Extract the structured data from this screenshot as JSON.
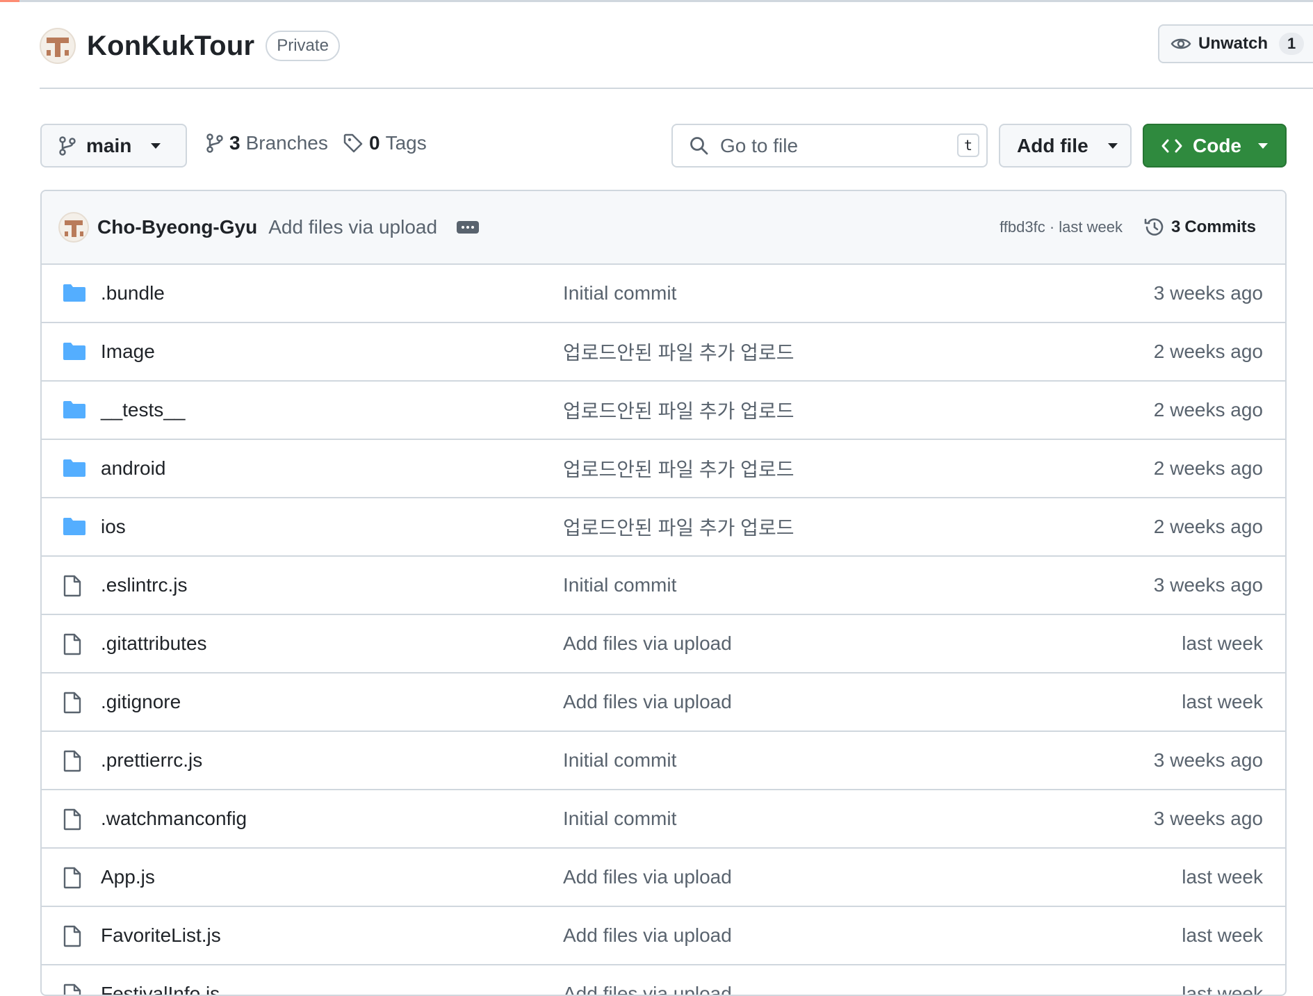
{
  "repo": {
    "name": "KonKukTour",
    "visibility": "Private",
    "avatar_icon": "user-avatar",
    "unwatch_label": "Unwatch",
    "watch_count": "1"
  },
  "toolbar": {
    "branch": "main",
    "branches_count": "3",
    "branches_label": "Branches",
    "tags_count": "0",
    "tags_label": "Tags",
    "search_placeholder": "Go to file",
    "search_shortcut": "t",
    "add_file_label": "Add file",
    "code_label": "Code",
    "code_color": "#2f8a3e"
  },
  "latest_commit": {
    "author": "Cho-Byeong-Gyu",
    "message": "Add files via upload",
    "hash_time": "ffbd3fc · last week",
    "commits_count": "3",
    "commits_label": "Commits"
  },
  "files": [
    {
      "type": "folder",
      "name": ".bundle",
      "message": "Initial commit",
      "age": "3 weeks ago"
    },
    {
      "type": "folder",
      "name": "Image",
      "message": "업로드안된 파일 추가 업로드",
      "age": "2 weeks ago"
    },
    {
      "type": "folder",
      "name": "__tests__",
      "message": "업로드안된 파일 추가 업로드",
      "age": "2 weeks ago"
    },
    {
      "type": "folder",
      "name": "android",
      "message": "업로드안된 파일 추가 업로드",
      "age": "2 weeks ago"
    },
    {
      "type": "folder",
      "name": "ios",
      "message": "업로드안된 파일 추가 업로드",
      "age": "2 weeks ago"
    },
    {
      "type": "file",
      "name": ".eslintrc.js",
      "message": "Initial commit",
      "age": "3 weeks ago"
    },
    {
      "type": "file",
      "name": ".gitattributes",
      "message": "Add files via upload",
      "age": "last week"
    },
    {
      "type": "file",
      "name": ".gitignore",
      "message": "Add files via upload",
      "age": "last week"
    },
    {
      "type": "file",
      "name": ".prettierrc.js",
      "message": "Initial commit",
      "age": "3 weeks ago"
    },
    {
      "type": "file",
      "name": ".watchmanconfig",
      "message": "Initial commit",
      "age": "3 weeks ago"
    },
    {
      "type": "file",
      "name": "App.js",
      "message": "Add files via upload",
      "age": "last week"
    },
    {
      "type": "file",
      "name": "FavoriteList.js",
      "message": "Add files via upload",
      "age": "last week"
    },
    {
      "type": "file",
      "name": "FestivalInfo.js",
      "message": "Add files via upload",
      "age": "last week"
    }
  ]
}
